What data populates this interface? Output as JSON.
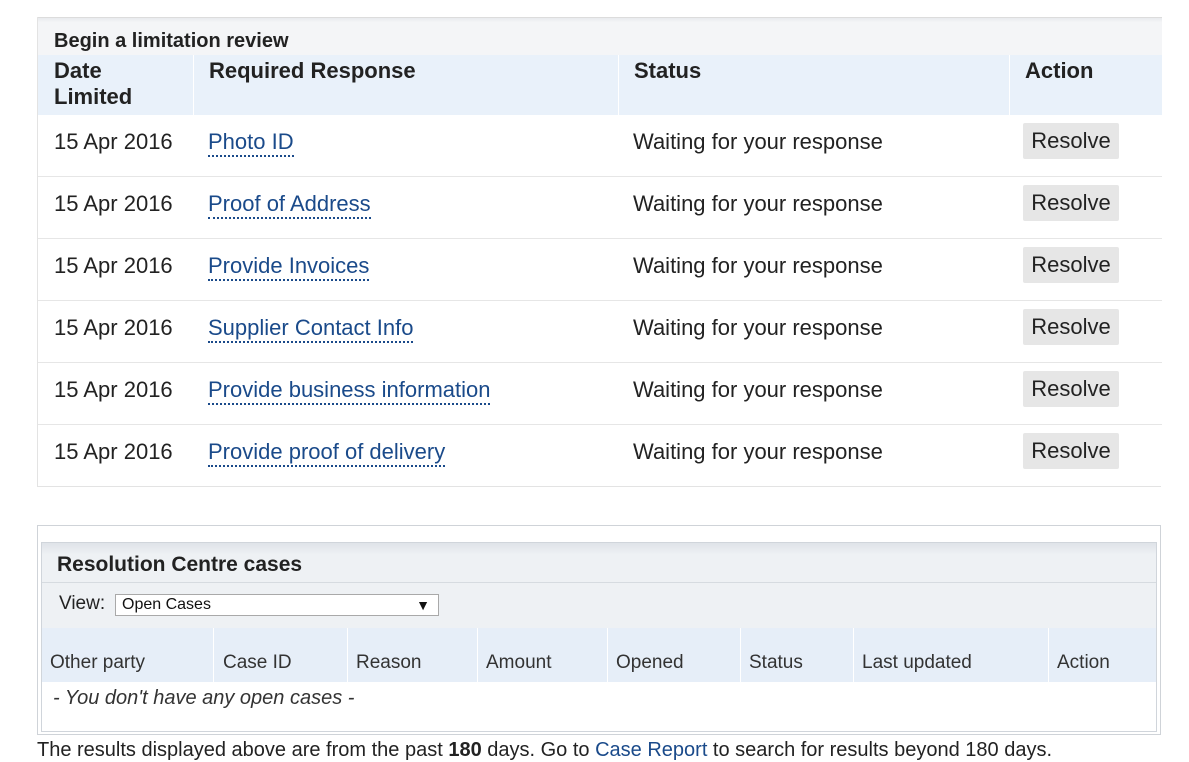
{
  "limitation": {
    "title": "Begin a limitation review",
    "headers": {
      "date": "Date Limited",
      "response": "Required Response",
      "status": "Status",
      "action": "Action"
    },
    "rows": [
      {
        "date": "15 Apr 2016",
        "response": "Photo ID",
        "status": "Waiting for your response",
        "action": "Resolve"
      },
      {
        "date": "15 Apr 2016",
        "response": "Proof of Address",
        "status": "Waiting for your response",
        "action": "Resolve"
      },
      {
        "date": "15 Apr 2016",
        "response": "Provide Invoices",
        "status": "Waiting for your response",
        "action": "Resolve"
      },
      {
        "date": "15 Apr 2016",
        "response": "Supplier Contact Info",
        "status": "Waiting for your response",
        "action": "Resolve"
      },
      {
        "date": "15 Apr 2016",
        "response": "Provide business information",
        "status": "Waiting for your response",
        "action": "Resolve"
      },
      {
        "date": "15 Apr 2016",
        "response": "Provide proof of delivery",
        "status": "Waiting for your response",
        "action": "Resolve"
      }
    ]
  },
  "resolution_centre": {
    "title": "Resolution Centre cases",
    "view_label": "View:",
    "view_selected": "Open Cases",
    "columns": [
      "Other party",
      "Case ID",
      "Reason",
      "Amount",
      "Opened",
      "Status",
      "Last updated",
      "Action"
    ],
    "empty_message": "- You don't have any open cases -"
  },
  "footer": {
    "text_before": "The results displayed above are from the past ",
    "days": "180",
    "text_mid": " days. Go to ",
    "link_label": "Case Report",
    "text_after": " to search for results beyond 180 days."
  }
}
